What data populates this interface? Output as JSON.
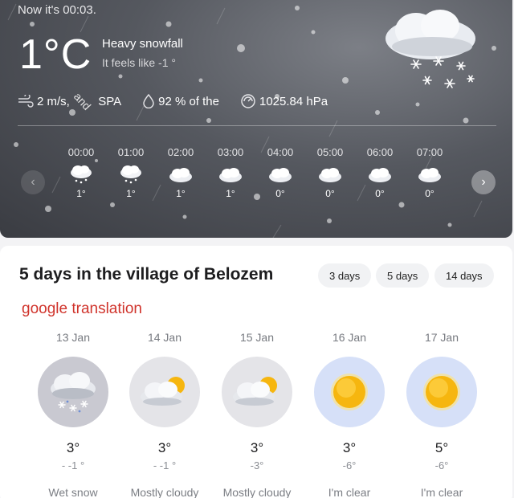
{
  "current": {
    "now_label": "Now it's 00:03.",
    "temperature": "1°C",
    "condition": "Heavy snowfall",
    "feels_like": "It feels like -1 °",
    "wind_speed": "2 m/s,",
    "wind_dir_word": "and",
    "wind_dir": "SPA",
    "humidity": "92 % of the",
    "pressure": "1025.84 hPa",
    "icon": "heavy-snow-cloud-icon"
  },
  "hourly": [
    {
      "time": "00:00",
      "temp": "1°",
      "icon": "snow-cloud-icon"
    },
    {
      "time": "01:00",
      "temp": "1°",
      "icon": "snow-cloud-icon"
    },
    {
      "time": "02:00",
      "temp": "1°",
      "icon": "cloud-icon"
    },
    {
      "time": "03:00",
      "temp": "1°",
      "icon": "cloud-icon"
    },
    {
      "time": "04:00",
      "temp": "0°",
      "icon": "cloud-icon"
    },
    {
      "time": "05:00",
      "temp": "0°",
      "icon": "cloud-icon"
    },
    {
      "time": "06:00",
      "temp": "0°",
      "icon": "cloud-icon"
    },
    {
      "time": "07:00",
      "temp": "0°",
      "icon": "cloud-icon"
    }
  ],
  "forecast": {
    "title": "5 days in the village of Belozem",
    "tabs": [
      "3 days",
      "5 days",
      "14 days"
    ],
    "translation_note": "google translation",
    "days": [
      {
        "date": "13 Jan",
        "high": "3°",
        "low": "- -1 °",
        "desc": "Wet snow",
        "icon": "wet-snow-icon",
        "bg": "#c9c9d1"
      },
      {
        "date": "14 Jan",
        "high": "3°",
        "low": "- -1 °",
        "desc": "Mostly cloudy",
        "icon": "mostly-cloudy-icon",
        "bg": "#e4e4e8"
      },
      {
        "date": "15 Jan",
        "high": "3°",
        "low": "-3°",
        "desc": "Mostly cloudy",
        "icon": "mostly-cloudy-icon",
        "bg": "#e4e4e8"
      },
      {
        "date": "16 Jan",
        "high": "3°",
        "low": "-6°",
        "desc": "I'm clear",
        "icon": "sun-icon",
        "bg": "#d6e0f8"
      },
      {
        "date": "17 Jan",
        "high": "5°",
        "low": "-6°",
        "desc": "I'm clear",
        "icon": "sun-icon",
        "bg": "#d6e0f8"
      }
    ]
  },
  "colors": {
    "accent_red": "#d0342c",
    "sun": "#f6b60f"
  }
}
